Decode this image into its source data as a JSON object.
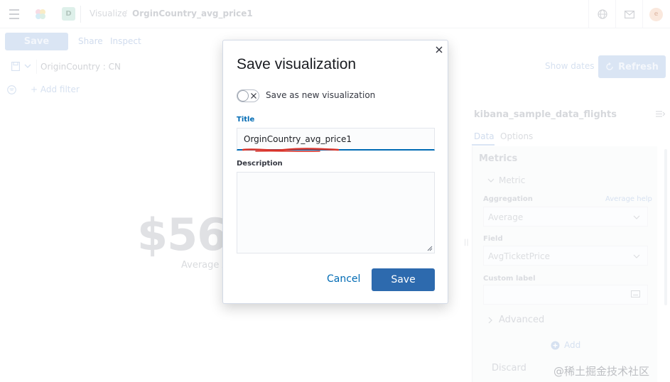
{
  "header": {
    "space_initial": "D",
    "breadcrumb_root": "Visualize",
    "breadcrumb_current": "OrginCountry_avg_price1",
    "user_initial": "e"
  },
  "toolbar": {
    "save_label": "Save",
    "share_label": "Share",
    "inspect_label": "Inspect"
  },
  "query_bar": {
    "query_text": "OriginCountry : CN",
    "show_dates_label": "Show dates",
    "refresh_label": "Refresh",
    "add_filter_label": "+ Add filter"
  },
  "preview": {
    "metric_value": "$56",
    "metric_label": "Average A"
  },
  "sidebar": {
    "index_pattern": "kibana_sample_data_flights",
    "tabs": [
      {
        "label": "Data"
      },
      {
        "label": "Options"
      }
    ],
    "metrics_heading": "Metrics",
    "metric_item_label": "Metric",
    "aggregation_label": "Aggregation",
    "aggregation_help": "Average help",
    "aggregation_value": "Average",
    "field_label": "Field",
    "field_value": "AvgTicketPrice",
    "custom_label_label": "Custom label",
    "advanced_label": "Advanced",
    "add_label": "Add",
    "discard_label": "Discard"
  },
  "watermark": "@稀土掘金技术社区",
  "modal": {
    "title": "Save visualization",
    "toggle_label": "Save as new visualization",
    "toggle_on": false,
    "title_field_label": "Title",
    "title_value": "OrginCountry_avg_price1",
    "description_label": "Description",
    "description_value": "",
    "cancel_label": "Cancel",
    "save_label": "Save"
  },
  "colors": {
    "primary": "#006bb4",
    "save_button": "#2d6aae",
    "annotation_mark": "#d9342b"
  },
  "icons": [
    "menu-icon",
    "kibana-logo-icon",
    "help-globe-icon",
    "mail-icon",
    "save-query-icon",
    "chevron-down-icon",
    "refresh-icon",
    "filter-icon",
    "collapse-sidebar-icon",
    "chevron-down-icon",
    "chevron-right-icon",
    "plus-circle-icon",
    "close-icon",
    "toggle-cross-icon"
  ]
}
